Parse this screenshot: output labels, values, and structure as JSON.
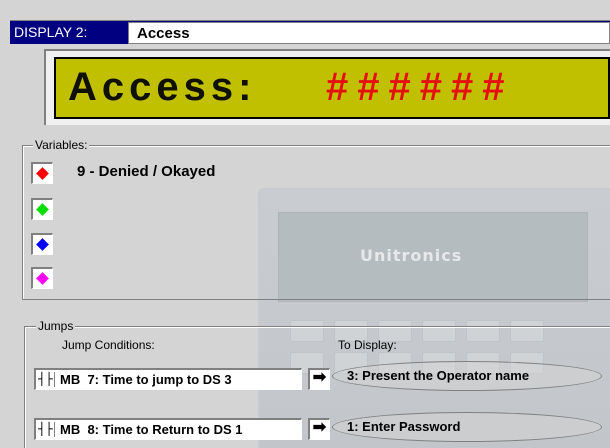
{
  "window": {
    "display_label": "DISPLAY 2:",
    "display_name": "Access"
  },
  "lcd": {
    "text": "Access:",
    "value": "######",
    "background_color": "#c0c000",
    "value_color": "#e41010"
  },
  "background": {
    "logo_text": "Unitronics"
  },
  "variables": {
    "legend": "Variables:",
    "items": [
      {
        "color": "#ff0000",
        "icon": "red-diamond-icon",
        "label": "9 - Denied / Okayed"
      },
      {
        "color": "#00e000",
        "icon": "green-diamond-icon",
        "label": ""
      },
      {
        "color": "#0000ff",
        "icon": "blue-diamond-icon",
        "label": ""
      },
      {
        "color": "#ff00ff",
        "icon": "magenta-diamond-icon",
        "label": ""
      }
    ]
  },
  "jumps": {
    "legend": "Jumps",
    "conditions_header": "Jump Conditions:",
    "display_header": "To Display:",
    "rows": [
      {
        "contact": "┤├",
        "condition": "MB  7: Time to jump to DS 3",
        "arrow": "➡",
        "destination": "3: Present the Operator name"
      },
      {
        "contact": "┤├",
        "condition": "MB  8: Time to Return to DS 1",
        "arrow": "➡",
        "destination": "1: Enter Password"
      }
    ]
  }
}
